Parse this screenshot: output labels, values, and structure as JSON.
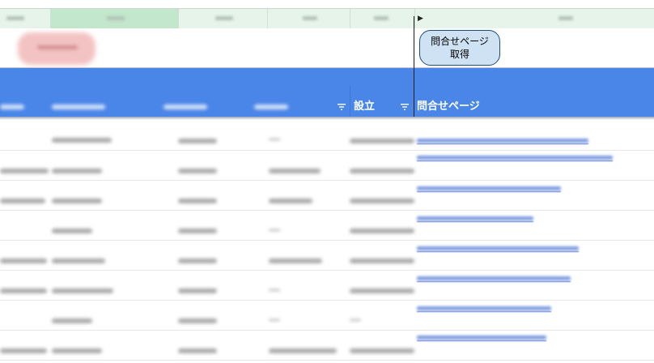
{
  "toolbar": {
    "fetch_button_label": "問合せページ\n取得"
  },
  "table": {
    "headers": {
      "established": "設立",
      "contact_page": "問合せページ"
    },
    "row_count": 8
  },
  "colors": {
    "header_bg": "#4a86e8",
    "button_bg": "#cfe2f3",
    "button_border": "#1f4e79",
    "column_header_bg": "#e6f4ea"
  }
}
